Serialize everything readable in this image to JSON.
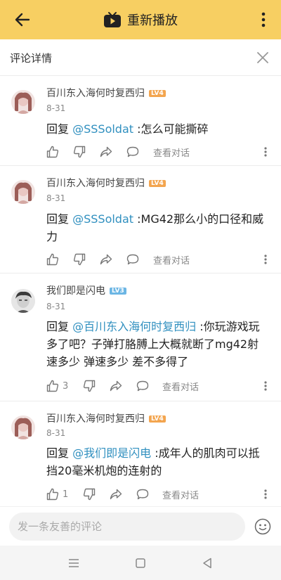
{
  "topbar": {
    "title": "重新播放",
    "back_icon": "arrow-left-icon",
    "video_icon": "play-video-icon",
    "more_icon": "more-vertical-icon",
    "bg_color": "#f7cf62"
  },
  "header": {
    "title": "评论详情",
    "close_icon": "close-icon"
  },
  "comments": [
    {
      "username": "百川东入海何时复西归",
      "level": "LV4",
      "level_color": "#f3a54f",
      "date": "8-31",
      "reply_prefix": "回复 ",
      "mention": "@SSSoldat",
      "text": " :怎么可能撕碎",
      "likes": "",
      "view_conversation": "查看对话"
    },
    {
      "username": "百川东入海何时复西归",
      "level": "LV4",
      "level_color": "#f3a54f",
      "date": "8-31",
      "reply_prefix": "回复 ",
      "mention": "@SSSoldat",
      "text": " :MG42那么小的口径和威力",
      "likes": "",
      "view_conversation": "查看对话"
    },
    {
      "username": "我们即是闪电",
      "level": "LV3",
      "level_color": "#6cb6e4",
      "date": "8-31",
      "reply_prefix": "回复 ",
      "mention": "@百川东入海何时复西归",
      "text": " :你玩游戏玩多了吧？子弹打胳膊上大概就断了mg42射速多少  弹速多少  差不多得了",
      "likes": "3",
      "view_conversation": "查看对话"
    },
    {
      "username": "百川东入海何时复西归",
      "level": "LV4",
      "level_color": "#f3a54f",
      "date": "8-31",
      "reply_prefix": "回复 ",
      "mention": "@我们即是闪电",
      "text": " :成年人的肌肉可以抵挡20毫米机炮的连射的",
      "likes": "1",
      "view_conversation": "查看对话"
    }
  ],
  "input": {
    "placeholder": "发一条友善的评论",
    "emoji_icon": "emoji-icon"
  },
  "navbar": {
    "menu_icon": "menu-icon",
    "home_icon": "home-square-icon",
    "back_icon": "back-triangle-icon"
  },
  "colors": {
    "mention": "#2f8fbf",
    "accent_yellow": "#f7cf62"
  }
}
